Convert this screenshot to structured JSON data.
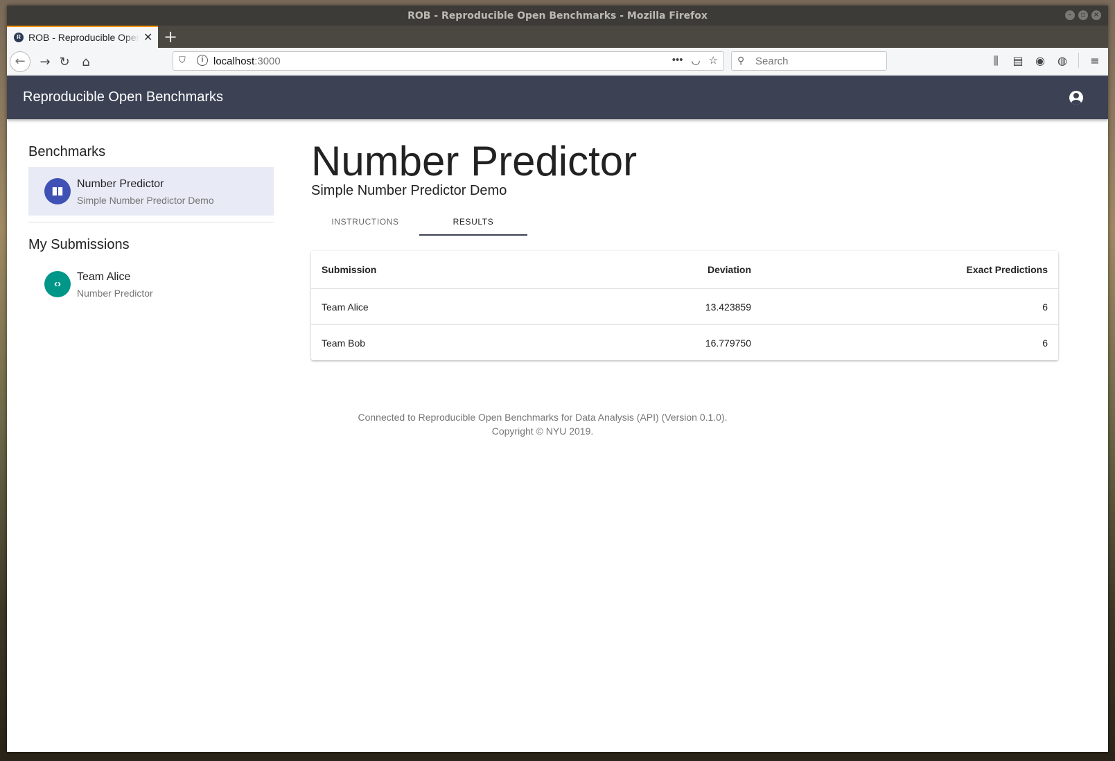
{
  "window": {
    "title": "ROB - Reproducible Open Benchmarks - Mozilla Firefox"
  },
  "browser": {
    "tab_title": "ROB - Reproducible Open Benchmarks",
    "favicon_letter": "R",
    "url_host": "localhost",
    "url_port": ":3000",
    "search_placeholder": "Search"
  },
  "app": {
    "title": "Reproducible Open Benchmarks",
    "header_color": "#3c4254"
  },
  "sidebar": {
    "benchmarks_heading": "Benchmarks",
    "benchmarks": [
      {
        "name": "Number Predictor",
        "description": "Simple Number Predictor Demo",
        "selected": true,
        "icon": "bar-chart-icon"
      }
    ],
    "submissions_heading": "My Submissions",
    "submissions": [
      {
        "name": "Team Alice",
        "benchmark": "Number Predictor",
        "icon": "code-icon"
      }
    ]
  },
  "main": {
    "title": "Number Predictor",
    "subtitle": "Simple Number Predictor Demo",
    "tabs": [
      {
        "label": "INSTRUCTIONS",
        "active": false
      },
      {
        "label": "RESULTS",
        "active": true
      }
    ],
    "results": {
      "columns": [
        "Submission",
        "Deviation",
        "Exact Predictions"
      ],
      "rows": [
        [
          "Team Alice",
          "13.423859",
          "6"
        ],
        [
          "Team Bob",
          "16.779750",
          "6"
        ]
      ]
    }
  },
  "footer": {
    "line1": "Connected to Reproducible Open Benchmarks for Data Analysis (API) (Version 0.1.0).",
    "line2": "Copyright © NYU 2019."
  }
}
